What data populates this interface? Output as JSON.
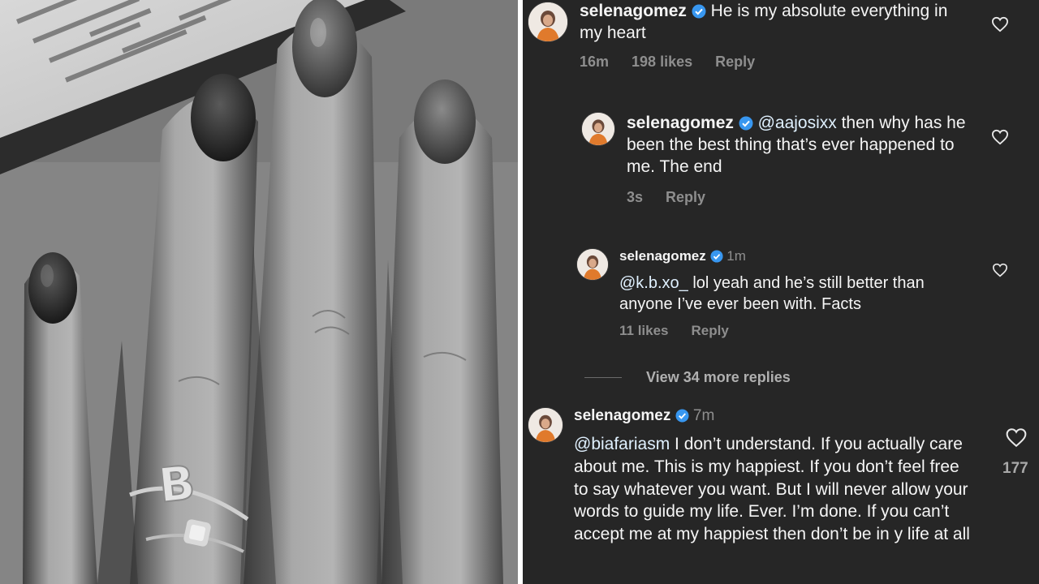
{
  "comments": [
    {
      "username": "selenagomez",
      "time": "",
      "mention": "",
      "text": "He is my absolute everything in my heart",
      "meta": {
        "time": "16m",
        "likes": "198 likes",
        "reply": "Reply"
      }
    },
    {
      "username": "selenagomez",
      "time": "",
      "mention": "@aajosixx",
      "text": " then why has he been the best thing that’s ever happened to me. The end",
      "meta": {
        "time": "3s",
        "likes": "",
        "reply": "Reply"
      }
    },
    {
      "username": "selenagomez",
      "time": "1m",
      "mention": "@k.b.xo_",
      "text": " lol yeah and he’s still better than anyone I’ve ever been with. Facts",
      "meta": {
        "time": "",
        "likes": "11 likes",
        "reply": "Reply"
      }
    },
    {
      "username": "selenagomez",
      "time": "7m",
      "mention": "@biafariasm",
      "text": " I don’t understand. If you actually care about me. This is my happiest. If you don’t feel free to say whatever you want. But I will never allow your words to guide my life. Ever. I’m done. If you can’t accept me at my happiest then don’t be in y life at all",
      "like_count": "177"
    }
  ],
  "view_more": "View 34 more replies",
  "photo": {
    "ring_letter": "B"
  },
  "colors": {
    "panel_bg": "#262626",
    "text": "#f5f5f5",
    "muted": "#8e8e8e",
    "verified": "#3897f0",
    "mention": "#e0f1ff"
  },
  "icons": [
    "verified-badge-icon",
    "heart-icon",
    "avatar-image"
  ]
}
